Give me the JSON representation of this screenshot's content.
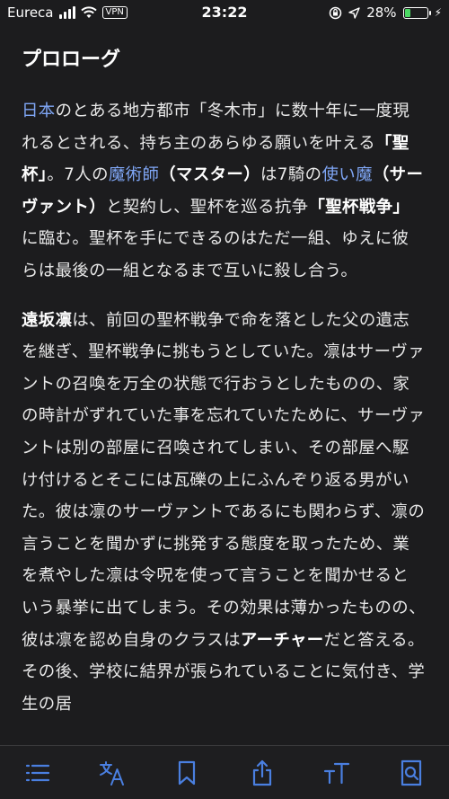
{
  "status_bar": {
    "carrier": "Eureca",
    "vpn": "VPN",
    "time": "23:22",
    "battery_percent": "28%",
    "battery_level": 0.28
  },
  "article": {
    "title": "プロローグ",
    "para1": [
      {
        "t": "日本",
        "s": "link"
      },
      {
        "t": "のとある地方都市「冬木市」に数十年に一度現れるとされる、持ち主のあらゆる願いを叶える",
        "s": ""
      },
      {
        "t": "「聖杯」",
        "s": "bold"
      },
      {
        "t": "。7人の",
        "s": ""
      },
      {
        "t": "魔術師",
        "s": "link"
      },
      {
        "t": "（マスター）",
        "s": "bold"
      },
      {
        "t": "は7騎の",
        "s": ""
      },
      {
        "t": "使い魔",
        "s": "link"
      },
      {
        "t": "（サーヴァント）",
        "s": "bold"
      },
      {
        "t": "と契約し、聖杯を巡る抗争",
        "s": ""
      },
      {
        "t": "「聖杯戦争」",
        "s": "bold"
      },
      {
        "t": "に臨む。聖杯を手にできるのはただ一組、ゆえに彼らは最後の一組となるまで互いに殺し合う。",
        "s": ""
      }
    ],
    "para2": [
      {
        "t": "遠坂凛",
        "s": "bold"
      },
      {
        "t": "は、前回の聖杯戦争で命を落とした父の遺志を継ぎ、聖杯戦争に挑もうとしていた。凛はサーヴァントの召喚を万全の状態で行おうとしたものの、家の時計がずれていた事を忘れていたために、サーヴァントは別の部屋に召喚されてしまい、その部屋へ駆け付けるとそこには瓦礫の上にふんぞり返る男がいた。彼は凛のサーヴァントであるにも関わらず、凛の言うことを聞かずに挑発する態度を取ったため、業を煮やした凛は令呪を使って言うことを聞かせるという暴挙に出てしまう。その効果は薄かったものの、彼は凛を認め自身のクラスは",
        "s": ""
      },
      {
        "t": "アーチャー",
        "s": "bold"
      },
      {
        "t": "だと答える。その後、学校に結界が張られていることに気付き、学生の居",
        "s": ""
      }
    ]
  },
  "toolbar": {
    "accent": "#4a7fe0",
    "icons": [
      "list-icon",
      "translate-icon",
      "bookmark-icon",
      "share-icon",
      "text-size-icon",
      "find-in-page-icon"
    ]
  },
  "colors": {
    "background": "#1c1c1e",
    "link": "#7fa6f5",
    "text": "#e8e8e8"
  }
}
